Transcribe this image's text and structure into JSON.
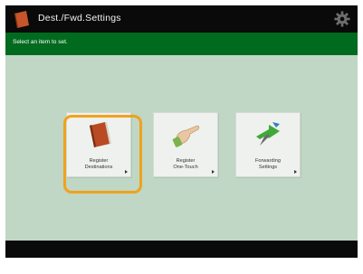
{
  "header": {
    "title": "Dest./Fwd.Settings",
    "title_icon": "dest-fwd-settings-icon",
    "settings_icon": "gear-icon"
  },
  "instruction": "Select an item to set.",
  "tiles": [
    {
      "line1": "Register",
      "line2": "Destinations",
      "icon": "address-book-icon",
      "selected": true
    },
    {
      "line1": "Register",
      "line2": "One-Touch",
      "icon": "hand-touch-icon",
      "selected": false
    },
    {
      "line1": "Forwarding",
      "line2": "Settings",
      "icon": "forwarding-arrow-icon",
      "selected": false
    }
  ],
  "colors": {
    "header": "#0a0a0a",
    "subbar": "#006b1e",
    "background": "#bfd7c4",
    "focus": "#f0a21d"
  }
}
